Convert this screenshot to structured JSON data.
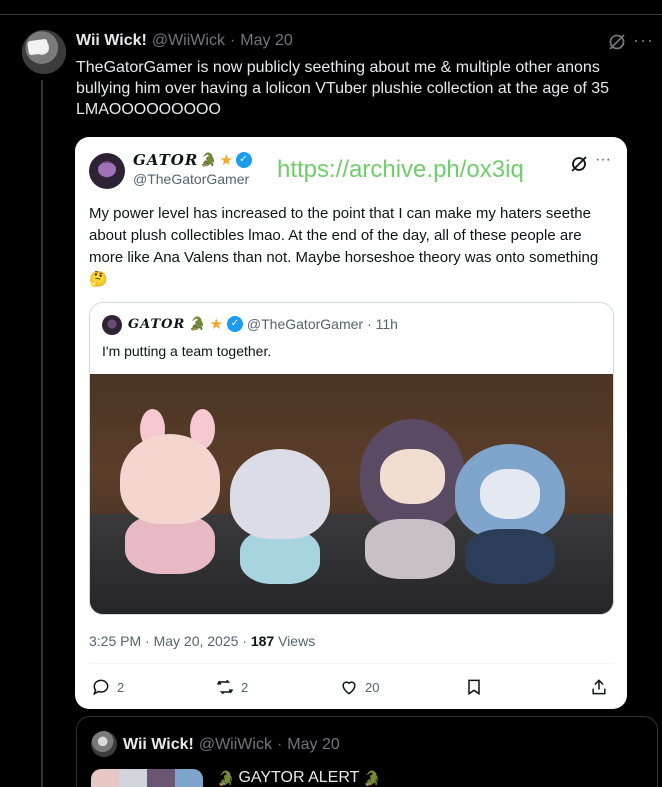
{
  "post": {
    "author_name": "Wii Wick!",
    "author_handle": "@WiiWick",
    "separator": "·",
    "date": "May 20",
    "text": "TheGatorGamer is now publicly seething about me & multiple other anons bullying him over having a lolicon VTuber plushie collection at the age of 35 LMAOOOOOOOOO"
  },
  "quoted": {
    "author_name": "GATOR",
    "author_handle": "@TheGatorGamer",
    "archive_link": "https://archive.ph/ox3iq",
    "text": "My power level has increased to the point that I can make my haters seethe about plush collectibles lmao. At the end of the day, all of these people are more like Ana Valens than not. Maybe horseshoe theory was onto something 🤔",
    "inner": {
      "author_name": "GATOR",
      "author_handle": "@TheGatorGamer",
      "time": "· 11h",
      "text": "I'm putting a team together."
    },
    "timestamp": "3:25 PM · May 20, 2025 · ",
    "views_count": "187",
    "views_label": " Views",
    "actions": {
      "replies": "2",
      "reposts": "2",
      "likes": "20"
    }
  },
  "reply": {
    "author_name": "Wii Wick!",
    "author_handle": "@WiiWick",
    "separator": "·",
    "date": "May 20",
    "text": "GAYTOR ALERT"
  },
  "colors": {
    "background": "#000000",
    "link_green": "#6fce6a",
    "verified_blue": "#1d9bf0",
    "muted": "#71767b"
  },
  "icons": [
    "grok-icon",
    "more-icon",
    "verified-icon",
    "reply-icon",
    "repost-icon",
    "like-icon",
    "bookmark-icon",
    "share-icon"
  ]
}
